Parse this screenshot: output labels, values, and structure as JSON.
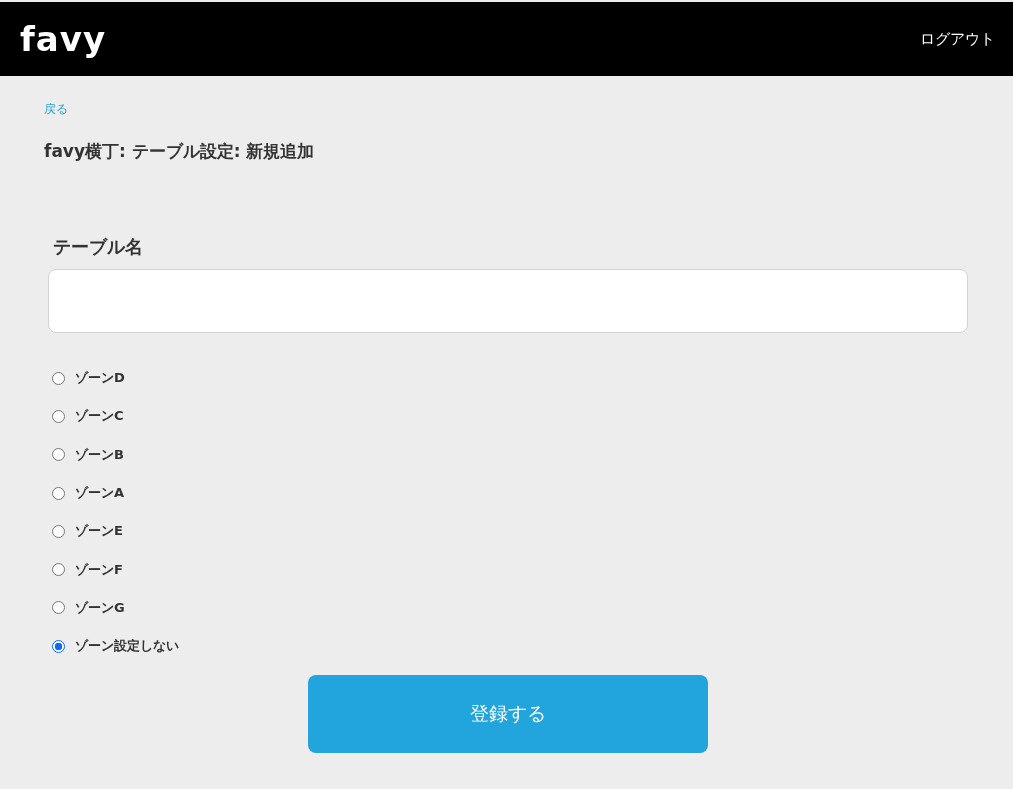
{
  "header": {
    "logo": "favy",
    "logout": "ログアウト"
  },
  "back_link": "戻る",
  "title": "favy横丁: テーブル設定: 新規追加",
  "form": {
    "table_name": {
      "label": "テーブル名"
    },
    "zones": [
      {
        "label": "ゾーンD",
        "selected": false
      },
      {
        "label": "ゾーンC",
        "selected": false
      },
      {
        "label": "ゾーンB",
        "selected": false
      },
      {
        "label": "ゾーンA",
        "selected": false
      },
      {
        "label": "ゾーンE",
        "selected": false
      },
      {
        "label": "ゾーンF",
        "selected": false
      },
      {
        "label": "ゾーンG",
        "selected": false
      },
      {
        "label": "ゾーン設定しない",
        "selected": true
      }
    ],
    "submit": "登録する"
  }
}
